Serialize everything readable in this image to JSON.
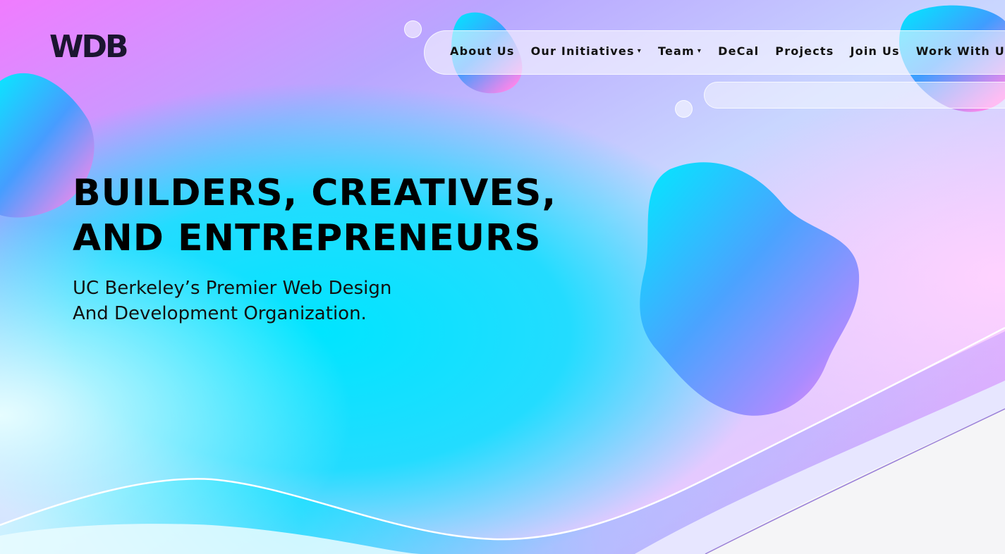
{
  "logo": {
    "text": "WDB"
  },
  "nav": {
    "items": [
      {
        "label": "About Us",
        "has_dropdown": false
      },
      {
        "label": "Our Initiatives",
        "has_dropdown": true
      },
      {
        "label": "Team",
        "has_dropdown": true
      },
      {
        "label": "DeCal",
        "has_dropdown": false
      },
      {
        "label": "Projects",
        "has_dropdown": false
      },
      {
        "label": "Join Us",
        "has_dropdown": false
      },
      {
        "label": "Work With Us",
        "has_dropdown": false
      }
    ],
    "dropdown_icon": "▾"
  },
  "hero": {
    "title_line1": "BUILDERS, CREATIVES,",
    "title_line2": "AND ENTREPRENEURS",
    "subtitle_line1": "UC Berkeley’s Premier Web Design",
    "subtitle_line2": "And Development Organization."
  },
  "colors": {
    "cyan": "#00e5ff",
    "blue": "#5aa0ff",
    "pink": "#ff7ee6",
    "violet": "#b58cff",
    "lavender": "#d9ccff",
    "logo": "#1b1530"
  }
}
